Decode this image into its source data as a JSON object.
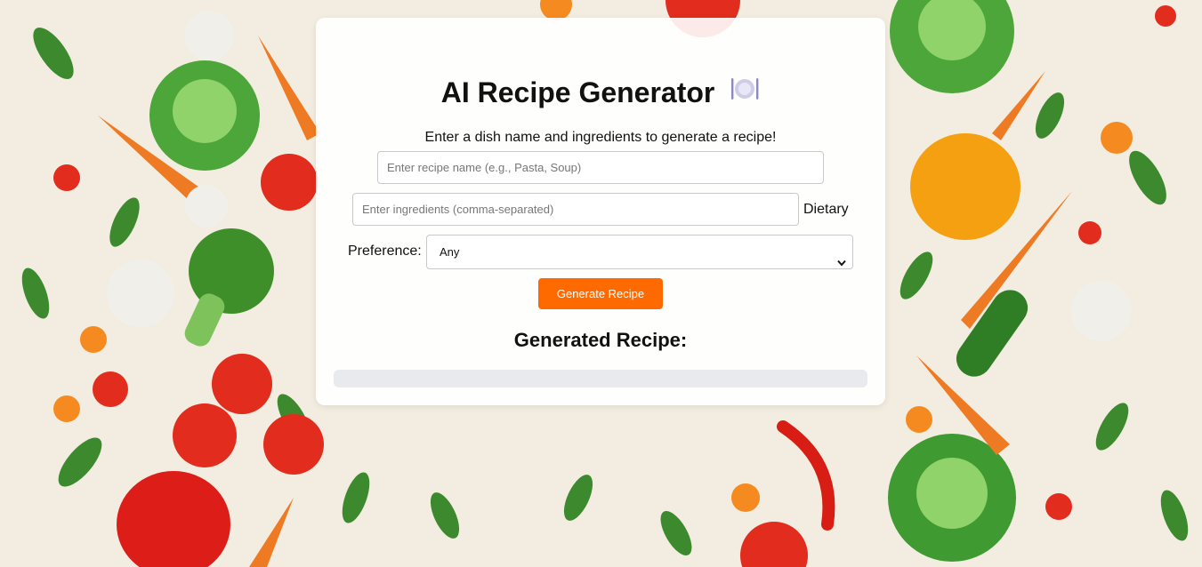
{
  "header": {
    "title": "AI Recipe Generator",
    "title_icon": "plate-cutlery-icon",
    "subtitle": "Enter a dish name and ingredients to generate a recipe!"
  },
  "form": {
    "recipe_name_placeholder": "Enter recipe name (e.g., Pasta, Soup)",
    "ingredients_placeholder": "Enter ingredients (comma-separated)",
    "dietary_label": "Dietary",
    "preference_label": "Preference:",
    "preference_selected": "Any",
    "generate_label": "Generate Recipe"
  },
  "result": {
    "title": "Generated Recipe:"
  },
  "colors": {
    "accent": "#ff6a00",
    "result_box": "#e8eaed"
  }
}
